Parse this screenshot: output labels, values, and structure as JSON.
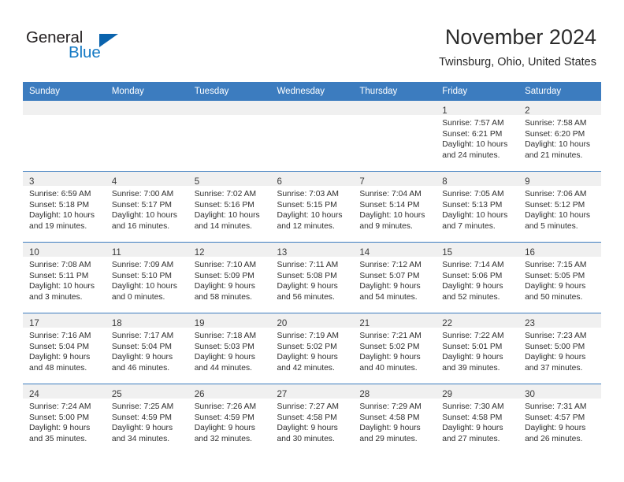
{
  "brand": {
    "name_part1": "General",
    "name_part2": "Blue",
    "accent_color": "#1479c4",
    "triangle_color": "#0a63ad"
  },
  "header": {
    "title": "November 2024",
    "subtitle": "Twinsburg, Ohio, United States"
  },
  "theme": {
    "header_row_bg": "#3c7cbf",
    "daynum_band_bg": "#f0f0f0",
    "grid_line": "#3c7cbf"
  },
  "weekdays": [
    "Sunday",
    "Monday",
    "Tuesday",
    "Wednesday",
    "Thursday",
    "Friday",
    "Saturday"
  ],
  "weeks": [
    [
      {
        "day": "",
        "empty": true
      },
      {
        "day": "",
        "empty": true
      },
      {
        "day": "",
        "empty": true
      },
      {
        "day": "",
        "empty": true
      },
      {
        "day": "",
        "empty": true
      },
      {
        "day": "1",
        "sunrise": "Sunrise: 7:57 AM",
        "sunset": "Sunset: 6:21 PM",
        "daylight1": "Daylight: 10 hours",
        "daylight2": "and 24 minutes."
      },
      {
        "day": "2",
        "sunrise": "Sunrise: 7:58 AM",
        "sunset": "Sunset: 6:20 PM",
        "daylight1": "Daylight: 10 hours",
        "daylight2": "and 21 minutes."
      }
    ],
    [
      {
        "day": "3",
        "sunrise": "Sunrise: 6:59 AM",
        "sunset": "Sunset: 5:18 PM",
        "daylight1": "Daylight: 10 hours",
        "daylight2": "and 19 minutes."
      },
      {
        "day": "4",
        "sunrise": "Sunrise: 7:00 AM",
        "sunset": "Sunset: 5:17 PM",
        "daylight1": "Daylight: 10 hours",
        "daylight2": "and 16 minutes."
      },
      {
        "day": "5",
        "sunrise": "Sunrise: 7:02 AM",
        "sunset": "Sunset: 5:16 PM",
        "daylight1": "Daylight: 10 hours",
        "daylight2": "and 14 minutes."
      },
      {
        "day": "6",
        "sunrise": "Sunrise: 7:03 AM",
        "sunset": "Sunset: 5:15 PM",
        "daylight1": "Daylight: 10 hours",
        "daylight2": "and 12 minutes."
      },
      {
        "day": "7",
        "sunrise": "Sunrise: 7:04 AM",
        "sunset": "Sunset: 5:14 PM",
        "daylight1": "Daylight: 10 hours",
        "daylight2": "and 9 minutes."
      },
      {
        "day": "8",
        "sunrise": "Sunrise: 7:05 AM",
        "sunset": "Sunset: 5:13 PM",
        "daylight1": "Daylight: 10 hours",
        "daylight2": "and 7 minutes."
      },
      {
        "day": "9",
        "sunrise": "Sunrise: 7:06 AM",
        "sunset": "Sunset: 5:12 PM",
        "daylight1": "Daylight: 10 hours",
        "daylight2": "and 5 minutes."
      }
    ],
    [
      {
        "day": "10",
        "sunrise": "Sunrise: 7:08 AM",
        "sunset": "Sunset: 5:11 PM",
        "daylight1": "Daylight: 10 hours",
        "daylight2": "and 3 minutes."
      },
      {
        "day": "11",
        "sunrise": "Sunrise: 7:09 AM",
        "sunset": "Sunset: 5:10 PM",
        "daylight1": "Daylight: 10 hours",
        "daylight2": "and 0 minutes."
      },
      {
        "day": "12",
        "sunrise": "Sunrise: 7:10 AM",
        "sunset": "Sunset: 5:09 PM",
        "daylight1": "Daylight: 9 hours",
        "daylight2": "and 58 minutes."
      },
      {
        "day": "13",
        "sunrise": "Sunrise: 7:11 AM",
        "sunset": "Sunset: 5:08 PM",
        "daylight1": "Daylight: 9 hours",
        "daylight2": "and 56 minutes."
      },
      {
        "day": "14",
        "sunrise": "Sunrise: 7:12 AM",
        "sunset": "Sunset: 5:07 PM",
        "daylight1": "Daylight: 9 hours",
        "daylight2": "and 54 minutes."
      },
      {
        "day": "15",
        "sunrise": "Sunrise: 7:14 AM",
        "sunset": "Sunset: 5:06 PM",
        "daylight1": "Daylight: 9 hours",
        "daylight2": "and 52 minutes."
      },
      {
        "day": "16",
        "sunrise": "Sunrise: 7:15 AM",
        "sunset": "Sunset: 5:05 PM",
        "daylight1": "Daylight: 9 hours",
        "daylight2": "and 50 minutes."
      }
    ],
    [
      {
        "day": "17",
        "sunrise": "Sunrise: 7:16 AM",
        "sunset": "Sunset: 5:04 PM",
        "daylight1": "Daylight: 9 hours",
        "daylight2": "and 48 minutes."
      },
      {
        "day": "18",
        "sunrise": "Sunrise: 7:17 AM",
        "sunset": "Sunset: 5:04 PM",
        "daylight1": "Daylight: 9 hours",
        "daylight2": "and 46 minutes."
      },
      {
        "day": "19",
        "sunrise": "Sunrise: 7:18 AM",
        "sunset": "Sunset: 5:03 PM",
        "daylight1": "Daylight: 9 hours",
        "daylight2": "and 44 minutes."
      },
      {
        "day": "20",
        "sunrise": "Sunrise: 7:19 AM",
        "sunset": "Sunset: 5:02 PM",
        "daylight1": "Daylight: 9 hours",
        "daylight2": "and 42 minutes."
      },
      {
        "day": "21",
        "sunrise": "Sunrise: 7:21 AM",
        "sunset": "Sunset: 5:02 PM",
        "daylight1": "Daylight: 9 hours",
        "daylight2": "and 40 minutes."
      },
      {
        "day": "22",
        "sunrise": "Sunrise: 7:22 AM",
        "sunset": "Sunset: 5:01 PM",
        "daylight1": "Daylight: 9 hours",
        "daylight2": "and 39 minutes."
      },
      {
        "day": "23",
        "sunrise": "Sunrise: 7:23 AM",
        "sunset": "Sunset: 5:00 PM",
        "daylight1": "Daylight: 9 hours",
        "daylight2": "and 37 minutes."
      }
    ],
    [
      {
        "day": "24",
        "sunrise": "Sunrise: 7:24 AM",
        "sunset": "Sunset: 5:00 PM",
        "daylight1": "Daylight: 9 hours",
        "daylight2": "and 35 minutes."
      },
      {
        "day": "25",
        "sunrise": "Sunrise: 7:25 AM",
        "sunset": "Sunset: 4:59 PM",
        "daylight1": "Daylight: 9 hours",
        "daylight2": "and 34 minutes."
      },
      {
        "day": "26",
        "sunrise": "Sunrise: 7:26 AM",
        "sunset": "Sunset: 4:59 PM",
        "daylight1": "Daylight: 9 hours",
        "daylight2": "and 32 minutes."
      },
      {
        "day": "27",
        "sunrise": "Sunrise: 7:27 AM",
        "sunset": "Sunset: 4:58 PM",
        "daylight1": "Daylight: 9 hours",
        "daylight2": "and 30 minutes."
      },
      {
        "day": "28",
        "sunrise": "Sunrise: 7:29 AM",
        "sunset": "Sunset: 4:58 PM",
        "daylight1": "Daylight: 9 hours",
        "daylight2": "and 29 minutes."
      },
      {
        "day": "29",
        "sunrise": "Sunrise: 7:30 AM",
        "sunset": "Sunset: 4:58 PM",
        "daylight1": "Daylight: 9 hours",
        "daylight2": "and 27 minutes."
      },
      {
        "day": "30",
        "sunrise": "Sunrise: 7:31 AM",
        "sunset": "Sunset: 4:57 PM",
        "daylight1": "Daylight: 9 hours",
        "daylight2": "and 26 minutes."
      }
    ]
  ]
}
